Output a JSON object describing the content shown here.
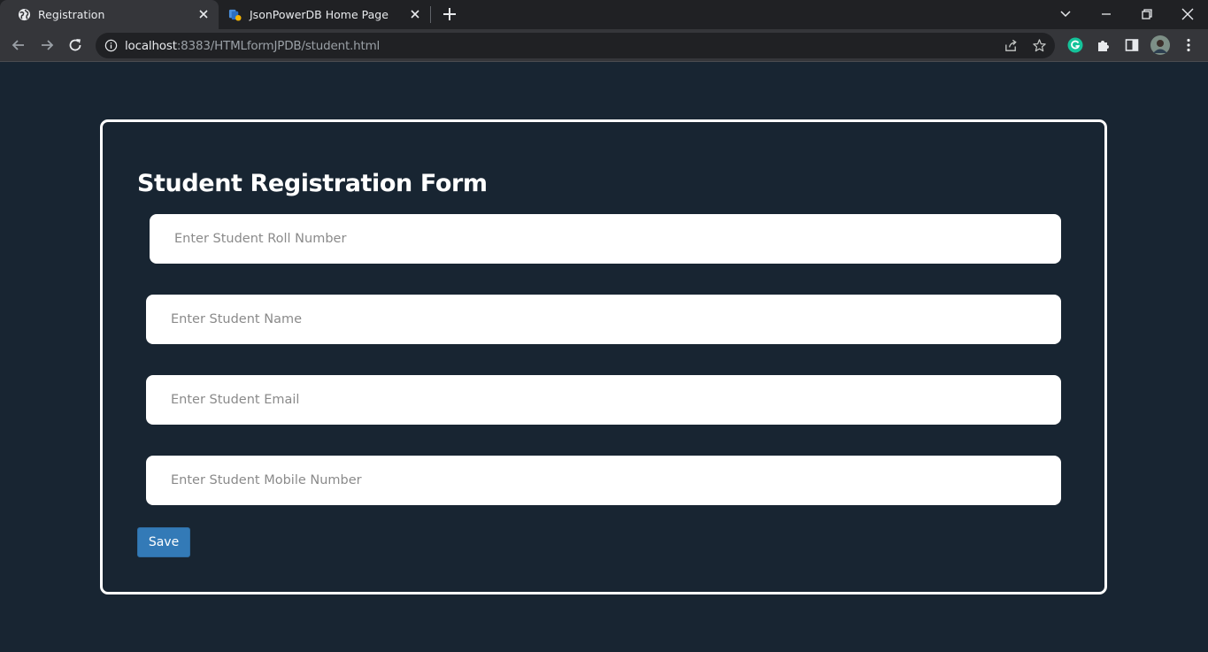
{
  "browser": {
    "tabs": [
      {
        "title": "Registration",
        "icon": "globe-icon",
        "active": true
      },
      {
        "title": "JsonPowerDB Home Page",
        "icon": "jsonpowerdb-favicon",
        "active": false
      }
    ],
    "url_host": "localhost",
    "url_rest": ":8383/HTMLformJPDB/student.html",
    "colors": {
      "tab_strip": "#202124",
      "toolbar": "#35363a",
      "grammarly": "#15c39a"
    }
  },
  "page": {
    "background": "#182532",
    "title": "Student Registration Form",
    "fields": [
      {
        "name": "roll-number",
        "placeholder": "Enter Student Roll Number",
        "value": ""
      },
      {
        "name": "name",
        "placeholder": "Enter Student Name",
        "value": ""
      },
      {
        "name": "email",
        "placeholder": "Enter Student Email",
        "value": ""
      },
      {
        "name": "mobile-number",
        "placeholder": "Enter Student Mobile Number",
        "value": ""
      }
    ],
    "save_label": "Save",
    "save_color": "#337ab7"
  }
}
